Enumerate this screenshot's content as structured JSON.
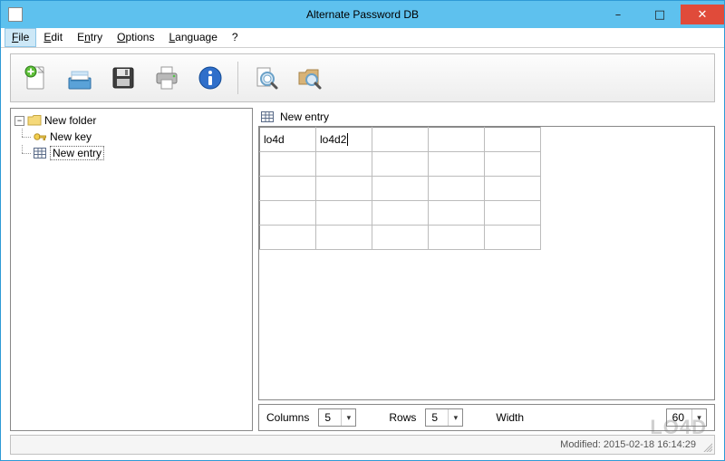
{
  "window": {
    "title": "Alternate Password DB",
    "controls": {
      "minimize": "–",
      "maximize": "□",
      "close": "✕"
    }
  },
  "menu": {
    "file": {
      "label": "File",
      "mnemonic_index": 0
    },
    "edit": {
      "label": "Edit",
      "mnemonic_index": 0
    },
    "entry": {
      "label": "Entry",
      "mnemonic_index": 1
    },
    "options": {
      "label": "Options",
      "mnemonic_index": 0
    },
    "language": {
      "label": "Language",
      "mnemonic_index": 0
    },
    "help": {
      "label": "?"
    }
  },
  "toolbar_icons": {
    "new": "new-document-icon",
    "open": "open-icon",
    "save": "save-icon",
    "print": "print-icon",
    "info": "info-icon",
    "find_doc": "search-document-icon",
    "find_folder": "search-folder-icon"
  },
  "tree": {
    "root": {
      "label": "New folder",
      "icon": "folder-icon"
    },
    "items": [
      {
        "label": "New key",
        "icon": "key-icon"
      },
      {
        "label": "New entry",
        "icon": "table-icon",
        "selected": true
      }
    ]
  },
  "entry_header": {
    "icon": "table-icon",
    "label": "New entry"
  },
  "grid": {
    "columns": 5,
    "rows": 5,
    "cells": {
      "r0c0": "lo4d",
      "r0c1": "lo4d2"
    },
    "cursor_cell": "r0c1"
  },
  "controls": {
    "columns_label": "Columns",
    "columns_value": "5",
    "rows_label": "Rows",
    "rows_value": "5",
    "width_label": "Width",
    "width_value": "60"
  },
  "statusbar": {
    "text": "Modified: 2015-02-18 16:14:29"
  },
  "watermark": "LO4D"
}
